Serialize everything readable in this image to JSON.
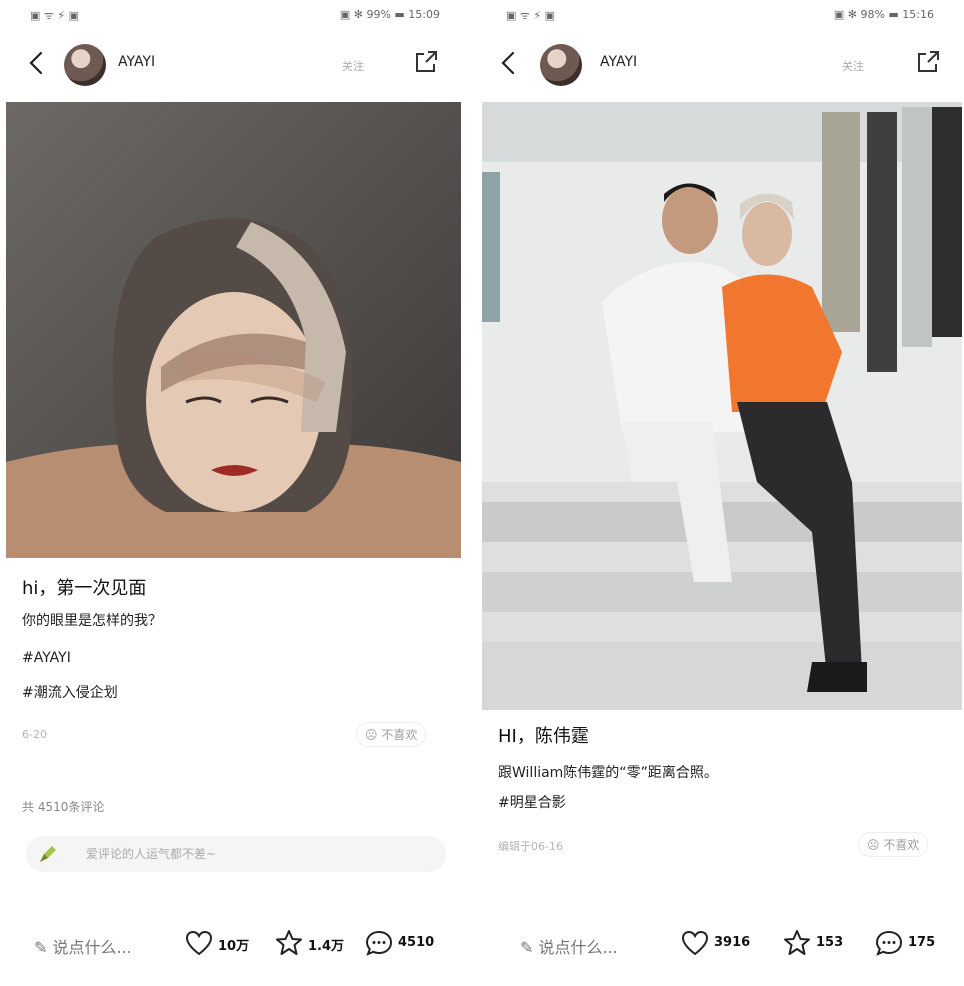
{
  "left": {
    "status": {
      "left": "▣ ᯤ ⚡ ▣",
      "right": "▣ ✻ 99% ▬ 15:09"
    },
    "username": "AYAYI",
    "follow_label": "关注",
    "post_title": "hi，第一次见面",
    "lines": [
      "你的眼里是怎样的我？",
      "#AYAYI",
      "#潮流入侵企划"
    ],
    "date": "6-20",
    "dislike_label": "不喜欢",
    "comments_count": "共 4510条评论",
    "comment_placeholder": "爱评论的人运气都不差~",
    "bottom": {
      "say": "说点什么...",
      "likes": "10万",
      "stars": "1.4万",
      "comments": "4510"
    }
  },
  "right": {
    "status": {
      "left": "▣ ᯤ ⚡ ▣",
      "right": "▣ ✻ 98% ▬ 15:16"
    },
    "username": "AYAYI",
    "follow_label": "关注",
    "post_title": "HI，陈伟霆",
    "lines": [
      "跟William陈伟霆的“零”距离合照。",
      "#明星合影"
    ],
    "date": "编辑于06-16",
    "dislike_label": "不喜欢",
    "bottom": {
      "say": "说点什么...",
      "likes": "3916",
      "stars": "153",
      "comments": "175"
    }
  }
}
